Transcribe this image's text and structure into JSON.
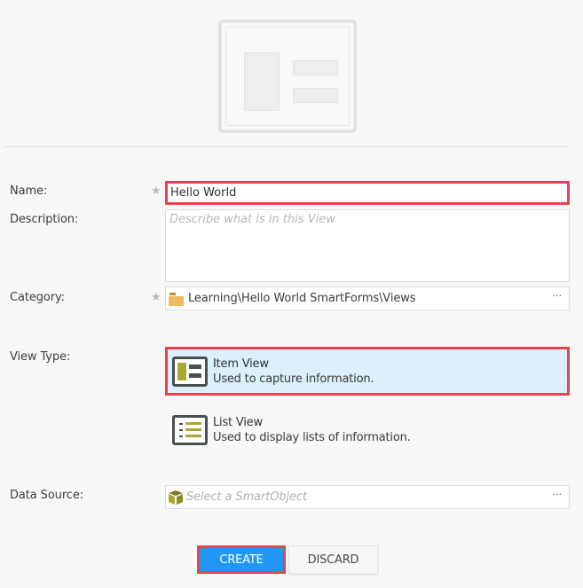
{
  "hero": {
    "icon": "item-view-large-icon"
  },
  "form": {
    "name": {
      "label": "Name:",
      "required_marker": "★",
      "value": "Hello World"
    },
    "description": {
      "label": "Description:",
      "placeholder": "Describe what is in this View",
      "value": ""
    },
    "category": {
      "label": "Category:",
      "required_marker": "★",
      "icon": "folder-icon",
      "value": "Learning\\Hello World SmartForms\\Views",
      "browse_label": "···"
    },
    "view_type": {
      "label": "View Type:",
      "selected": "Item View",
      "options": [
        {
          "title": "Item View",
          "description": "Used to capture information.",
          "icon": "item-view-icon"
        },
        {
          "title": "List View",
          "description": "Used to display lists of information.",
          "icon": "list-view-icon"
        }
      ]
    },
    "data_source": {
      "label": "Data Source:",
      "icon": "smartobject-cube-icon",
      "placeholder": "Select a SmartObject",
      "browse_label": "···"
    }
  },
  "actions": {
    "create_label": "CREATE",
    "discard_label": "DISCARD"
  },
  "colors": {
    "highlight_border": "#e9434a",
    "primary": "#2196f3",
    "selected_bg": "#dceffd",
    "icon_accent": "#a8a832"
  }
}
